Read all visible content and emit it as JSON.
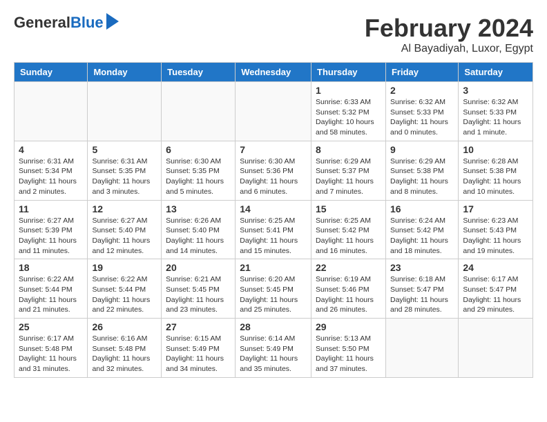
{
  "header": {
    "logo_general": "General",
    "logo_blue": "Blue",
    "month_year": "February 2024",
    "location": "Al Bayadiyah, Luxor, Egypt"
  },
  "weekdays": [
    "Sunday",
    "Monday",
    "Tuesday",
    "Wednesday",
    "Thursday",
    "Friday",
    "Saturday"
  ],
  "weeks": [
    [
      {
        "day": "",
        "info": ""
      },
      {
        "day": "",
        "info": ""
      },
      {
        "day": "",
        "info": ""
      },
      {
        "day": "",
        "info": ""
      },
      {
        "day": "1",
        "info": "Sunrise: 6:33 AM\nSunset: 5:32 PM\nDaylight: 10 hours and 58 minutes."
      },
      {
        "day": "2",
        "info": "Sunrise: 6:32 AM\nSunset: 5:33 PM\nDaylight: 11 hours and 0 minutes."
      },
      {
        "day": "3",
        "info": "Sunrise: 6:32 AM\nSunset: 5:33 PM\nDaylight: 11 hours and 1 minute."
      }
    ],
    [
      {
        "day": "4",
        "info": "Sunrise: 6:31 AM\nSunset: 5:34 PM\nDaylight: 11 hours and 2 minutes."
      },
      {
        "day": "5",
        "info": "Sunrise: 6:31 AM\nSunset: 5:35 PM\nDaylight: 11 hours and 3 minutes."
      },
      {
        "day": "6",
        "info": "Sunrise: 6:30 AM\nSunset: 5:35 PM\nDaylight: 11 hours and 5 minutes."
      },
      {
        "day": "7",
        "info": "Sunrise: 6:30 AM\nSunset: 5:36 PM\nDaylight: 11 hours and 6 minutes."
      },
      {
        "day": "8",
        "info": "Sunrise: 6:29 AM\nSunset: 5:37 PM\nDaylight: 11 hours and 7 minutes."
      },
      {
        "day": "9",
        "info": "Sunrise: 6:29 AM\nSunset: 5:38 PM\nDaylight: 11 hours and 8 minutes."
      },
      {
        "day": "10",
        "info": "Sunrise: 6:28 AM\nSunset: 5:38 PM\nDaylight: 11 hours and 10 minutes."
      }
    ],
    [
      {
        "day": "11",
        "info": "Sunrise: 6:27 AM\nSunset: 5:39 PM\nDaylight: 11 hours and 11 minutes."
      },
      {
        "day": "12",
        "info": "Sunrise: 6:27 AM\nSunset: 5:40 PM\nDaylight: 11 hours and 12 minutes."
      },
      {
        "day": "13",
        "info": "Sunrise: 6:26 AM\nSunset: 5:40 PM\nDaylight: 11 hours and 14 minutes."
      },
      {
        "day": "14",
        "info": "Sunrise: 6:25 AM\nSunset: 5:41 PM\nDaylight: 11 hours and 15 minutes."
      },
      {
        "day": "15",
        "info": "Sunrise: 6:25 AM\nSunset: 5:42 PM\nDaylight: 11 hours and 16 minutes."
      },
      {
        "day": "16",
        "info": "Sunrise: 6:24 AM\nSunset: 5:42 PM\nDaylight: 11 hours and 18 minutes."
      },
      {
        "day": "17",
        "info": "Sunrise: 6:23 AM\nSunset: 5:43 PM\nDaylight: 11 hours and 19 minutes."
      }
    ],
    [
      {
        "day": "18",
        "info": "Sunrise: 6:22 AM\nSunset: 5:44 PM\nDaylight: 11 hours and 21 minutes."
      },
      {
        "day": "19",
        "info": "Sunrise: 6:22 AM\nSunset: 5:44 PM\nDaylight: 11 hours and 22 minutes."
      },
      {
        "day": "20",
        "info": "Sunrise: 6:21 AM\nSunset: 5:45 PM\nDaylight: 11 hours and 23 minutes."
      },
      {
        "day": "21",
        "info": "Sunrise: 6:20 AM\nSunset: 5:45 PM\nDaylight: 11 hours and 25 minutes."
      },
      {
        "day": "22",
        "info": "Sunrise: 6:19 AM\nSunset: 5:46 PM\nDaylight: 11 hours and 26 minutes."
      },
      {
        "day": "23",
        "info": "Sunrise: 6:18 AM\nSunset: 5:47 PM\nDaylight: 11 hours and 28 minutes."
      },
      {
        "day": "24",
        "info": "Sunrise: 6:17 AM\nSunset: 5:47 PM\nDaylight: 11 hours and 29 minutes."
      }
    ],
    [
      {
        "day": "25",
        "info": "Sunrise: 6:17 AM\nSunset: 5:48 PM\nDaylight: 11 hours and 31 minutes."
      },
      {
        "day": "26",
        "info": "Sunrise: 6:16 AM\nSunset: 5:48 PM\nDaylight: 11 hours and 32 minutes."
      },
      {
        "day": "27",
        "info": "Sunrise: 6:15 AM\nSunset: 5:49 PM\nDaylight: 11 hours and 34 minutes."
      },
      {
        "day": "28",
        "info": "Sunrise: 6:14 AM\nSunset: 5:49 PM\nDaylight: 11 hours and 35 minutes."
      },
      {
        "day": "29",
        "info": "Sunrise: 5:13 AM\nSunset: 5:50 PM\nDaylight: 11 hours and 37 minutes."
      },
      {
        "day": "",
        "info": ""
      },
      {
        "day": "",
        "info": ""
      }
    ]
  ]
}
